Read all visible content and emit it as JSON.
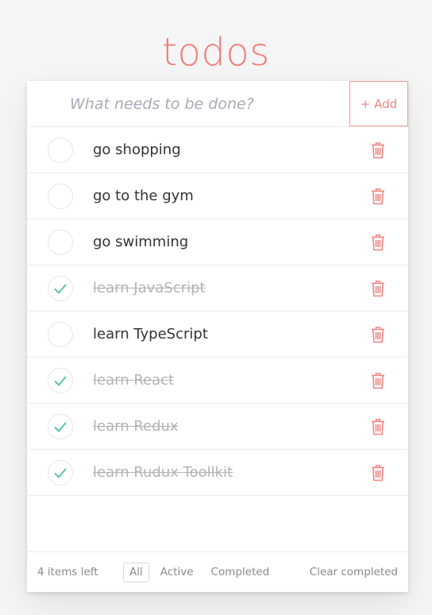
{
  "app": {
    "title": "todos"
  },
  "header": {
    "placeholder": "What needs to be done?",
    "add_label": "+ Add"
  },
  "todos": [
    {
      "label": "go shopping",
      "completed": false
    },
    {
      "label": "go to the gym",
      "completed": false
    },
    {
      "label": "go swimming",
      "completed": false
    },
    {
      "label": "learn JavaScript",
      "completed": true
    },
    {
      "label": "learn TypeScript",
      "completed": false
    },
    {
      "label": "learn React",
      "completed": true
    },
    {
      "label": "learn Redux",
      "completed": true
    },
    {
      "label": "learn Rudux Toollkit",
      "completed": true
    }
  ],
  "footer": {
    "items_left": "4 items left",
    "filters": [
      "All",
      "Active",
      "Completed"
    ],
    "selected_filter": "All",
    "clear_label": "Clear completed"
  },
  "colors": {
    "accent": "#ef7f7c",
    "check": "#5dc2af",
    "trash": "#ef8683"
  },
  "icons": {
    "toggle": "check-icon",
    "delete": "trash-icon"
  }
}
